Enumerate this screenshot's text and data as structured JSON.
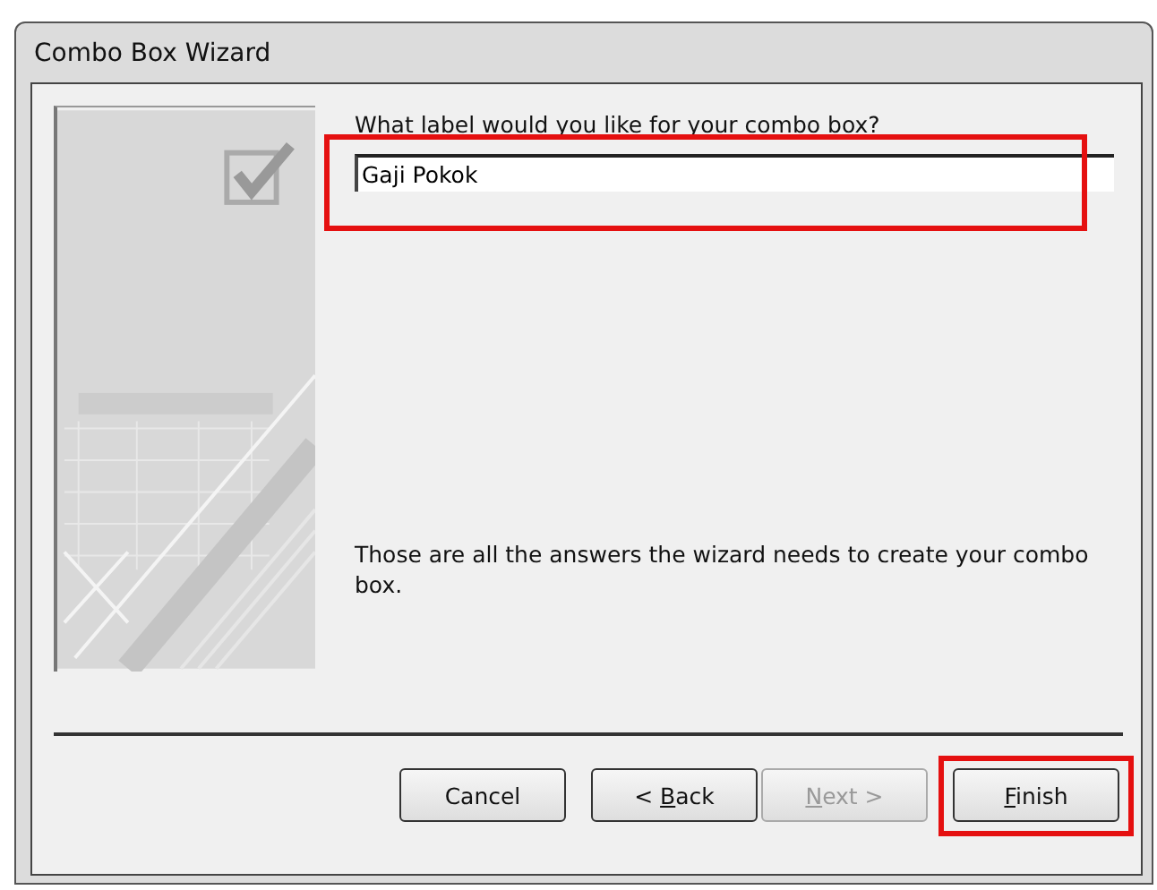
{
  "window": {
    "title": "Combo Box Wizard"
  },
  "question": "What label would you like for your combo box?",
  "label_field": {
    "value": "Gaji Pokok",
    "highlighted": true
  },
  "message": "Those are all the answers the wizard needs to create your combo box.",
  "buttons": [
    {
      "label_before": "Cancel",
      "disabled": false,
      "highlighted": false
    },
    {
      "label_before": "< ",
      "access_key": "B",
      "label_after": "ack",
      "disabled": false,
      "highlighted": false
    },
    {
      "access_key": "N",
      "label_after": "ext >",
      "disabled": true,
      "highlighted": false
    },
    {
      "access_key": "F",
      "label_after": "inish",
      "disabled": false,
      "highlighted": true
    }
  ]
}
